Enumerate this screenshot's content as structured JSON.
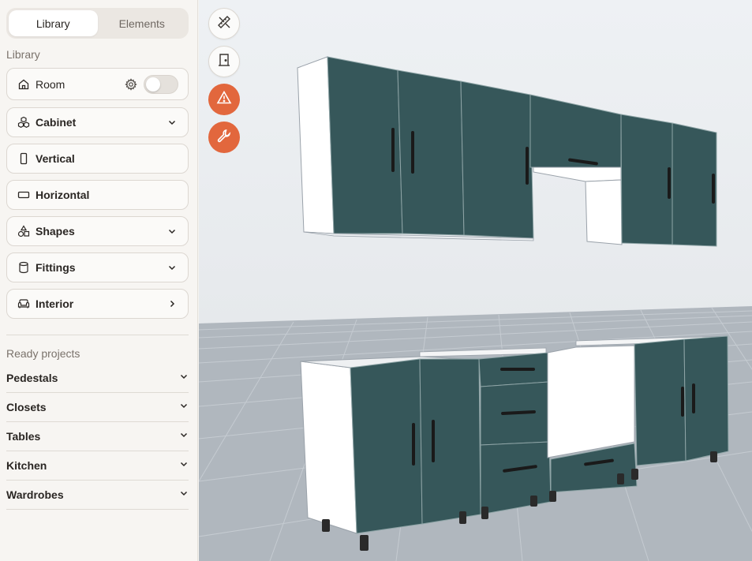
{
  "tabs": [
    {
      "label": "Library",
      "active": true
    },
    {
      "label": "Elements",
      "active": false
    }
  ],
  "library": {
    "heading": "Library",
    "room": {
      "label": "Room",
      "toggle_on": false
    },
    "items": [
      {
        "label": "Cabinet",
        "icon": "cubes-icon",
        "chevron": "down"
      },
      {
        "label": "Vertical",
        "icon": "vertical-rect-icon",
        "chevron": "none"
      },
      {
        "label": "Horizontal",
        "icon": "horizontal-rect-icon",
        "chevron": "none"
      },
      {
        "label": "Shapes",
        "icon": "shapes-icon",
        "chevron": "down"
      },
      {
        "label": "Fittings",
        "icon": "cylinder-icon",
        "chevron": "down"
      },
      {
        "label": "Interior",
        "icon": "sofa-icon",
        "chevron": "right"
      }
    ]
  },
  "ready_projects": {
    "heading": "Ready projects",
    "items": [
      "Pedestals",
      "Closets",
      "Tables",
      "Kitchen",
      "Wardrobes"
    ]
  },
  "toolbar": [
    {
      "name": "design-tools-button",
      "icon": "ruler-pencil-icon",
      "style": "white"
    },
    {
      "name": "door-button",
      "icon": "door-icon",
      "style": "white"
    },
    {
      "name": "warning-button",
      "icon": "warning-icon",
      "style": "orange"
    },
    {
      "name": "wrench-button",
      "icon": "wrench-icon",
      "style": "orange"
    }
  ],
  "colors": {
    "accent": "#e2673d",
    "cabinet_front": "#36575a",
    "carcass": "#ffffff",
    "floor": "#aeb6be",
    "wall": "#eceff2"
  }
}
